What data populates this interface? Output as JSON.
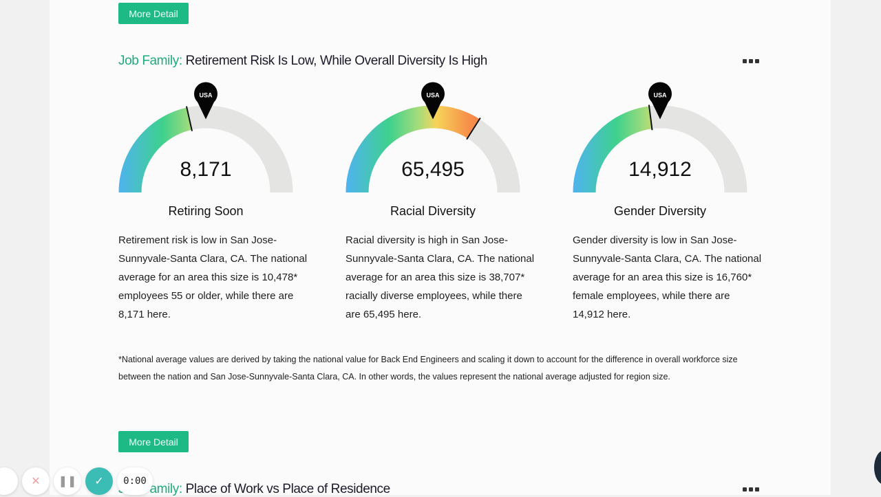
{
  "more_detail_label": "More Detail",
  "section": {
    "prefix": "Job Family:",
    "title": "Retirement Risk Is Low, While Overall Diversity Is High"
  },
  "marker_label": "USA",
  "gauges": [
    {
      "value": "8,171",
      "label": "Retiring Soon",
      "fill_fraction": 0.43,
      "desc": "Retirement risk is low in San Jose-Sunnyvale-Santa Clara, CA. The national average for an area this size is 10,478* employees 55 or older, while there are 8,171 here."
    },
    {
      "value": "65,495",
      "label": "Racial Diversity",
      "fill_fraction": 0.68,
      "desc": "Racial diversity is high in San Jose-Sunnyvale-Santa Clara, CA. The national average for an area this size is 38,707* racially diverse employees, while there are 65,495 here."
    },
    {
      "value": "14,912",
      "label": "Gender Diversity",
      "fill_fraction": 0.46,
      "desc": "Gender diversity is low in San Jose-Sunnyvale-Santa Clara, CA. The national average for an area this size is 16,760* female employees, while there are 14,912 here."
    }
  ],
  "footnote": "*National average values are derived by taking the national value for Back End Engineers and scaling it down to account for the difference in overall workforce size between the nation and San Jose-Sunnyvale-Santa Clara, CA. In other words, the values represent the national average adjusted for region size.",
  "next_section": {
    "prefix": "Job Family:",
    "title": "Place of Work vs Place of Residence"
  },
  "recorder": {
    "time": "0:00"
  },
  "colors": {
    "accent": "#1dba86",
    "track": "#e4e4e2"
  }
}
